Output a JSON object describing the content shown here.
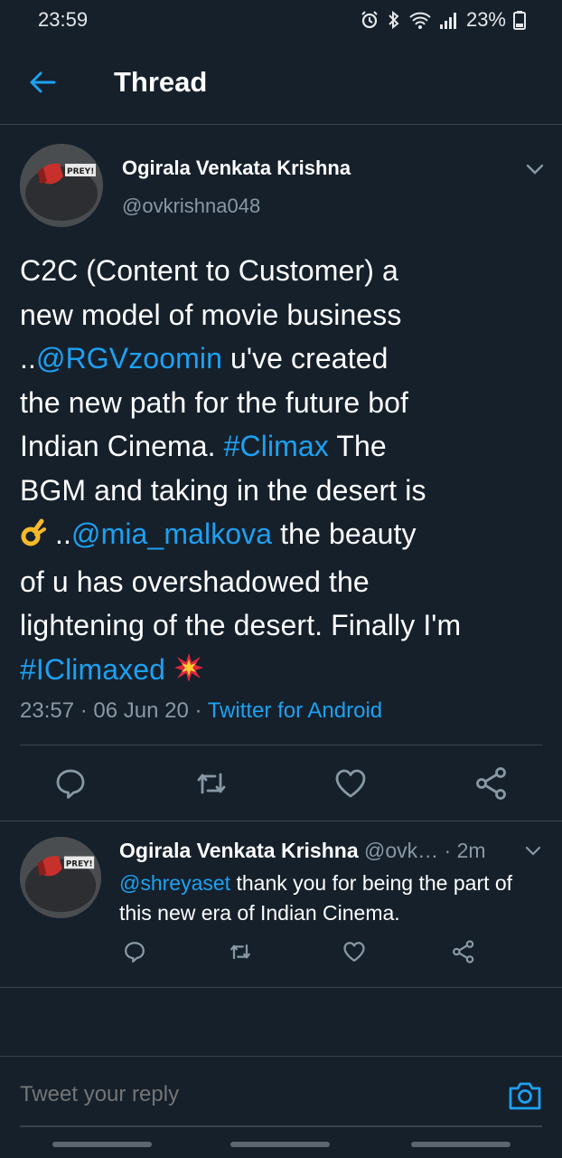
{
  "status_bar": {
    "time": "23:59",
    "battery": "23%",
    "icons": [
      "alarm-icon",
      "bluetooth-icon",
      "wifi-icon",
      "signal-icon",
      "battery-icon"
    ]
  },
  "header": {
    "title": "Thread",
    "back_icon": "arrow-left-icon"
  },
  "main_tweet": {
    "author_name": "Ogirala Venkata Krishna",
    "author_handle": "@ovkrishna048",
    "text": {
      "l1": "C2C (Content to Customer) a",
      "l2": "new model of movie business",
      "l3_pre": "..",
      "l3_mention": "@RGVzoomin",
      "l3_post": " u've created",
      "l4": "the new path for the future bof",
      "l5_pre": "Indian Cinema. ",
      "l5_tag": "#Climax",
      "l5_post": " The",
      "l6": "BGM and taking in the desert is",
      "l7_pre": " ..",
      "l7_mention": "@mia_malkova",
      "l7_post": " the beauty",
      "l8": "of u has overshadowed the",
      "l9": "lightening of the desert. Finally I'm",
      "l10_tag": "#IClimaxed",
      "emoji_ok": "ok-hand-emoji",
      "emoji_collision": "collision-emoji"
    },
    "time": "23:57",
    "date": "06 Jun 20",
    "separator": " · ",
    "source": "Twitter for Android",
    "actions": [
      "reply-icon",
      "retweet-icon",
      "like-icon",
      "share-icon"
    ]
  },
  "reply_tweet": {
    "author_name": "Ogirala Venkata Krishna",
    "author_handle": "@ovk…",
    "time": " · 2m",
    "mention": "@shreyaset",
    "text": " thank you for being the part of this new era of Indian Cinema.",
    "actions": [
      "reply-icon",
      "retweet-icon",
      "like-icon",
      "share-icon"
    ]
  },
  "compose": {
    "placeholder": "Tweet your reply",
    "camera_icon": "camera-icon"
  },
  "avatar_badge": "PREY!",
  "colors": {
    "background": "#15202b",
    "accent": "#1da1f2",
    "secondary_text": "#8899a6",
    "divider": "#38444d"
  }
}
